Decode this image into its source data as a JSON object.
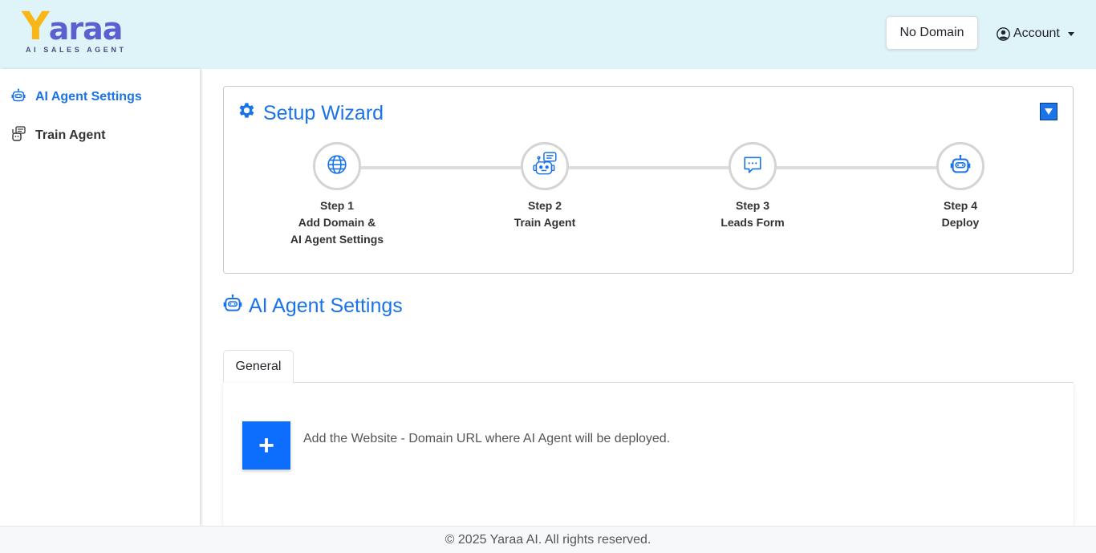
{
  "brand": {
    "logo_initial": "Y",
    "logo_rest": "araa",
    "tagline": "AI SALES AGENT",
    "colors": {
      "logo_yellow": "#f8b618",
      "logo_purple": "#5b5fcf",
      "accent": "#1a73e8",
      "header_bg": "#dff4f9",
      "primary_button": "#0d6efd"
    }
  },
  "header": {
    "domain_button": "No Domain",
    "account_label": "Account",
    "account_icon": "user-circle-icon"
  },
  "sidebar": {
    "items": [
      {
        "label": "AI Agent Settings",
        "icon": "robot-icon",
        "active": true
      },
      {
        "label": "Train Agent",
        "icon": "train-agent-icon",
        "active": false
      }
    ]
  },
  "wizard": {
    "title": "Setup Wizard",
    "title_icon": "gear-icon",
    "toggle_icon": "collapse-toggle-icon",
    "steps": [
      {
        "step": "Step 1",
        "line1": "Add Domain &",
        "line2": "AI Agent Settings",
        "icon": "globe-icon"
      },
      {
        "step": "Step 2",
        "line1": "Train Agent",
        "line2": "",
        "icon": "robot-chat-icon"
      },
      {
        "step": "Step 3",
        "line1": "Leads Form",
        "line2": "",
        "icon": "chat-bubble-icon"
      },
      {
        "step": "Step 4",
        "line1": "Deploy",
        "line2": "",
        "icon": "robot-icon"
      }
    ]
  },
  "main": {
    "section_title": "AI Agent Settings",
    "section_icon": "robot-icon",
    "tabs": [
      {
        "label": "General",
        "active": true
      }
    ],
    "add_button": "+",
    "add_text": "Add the Website - Domain URL where AI Agent will be deployed."
  },
  "footer": {
    "text": "© 2025 Yaraa AI. All rights reserved."
  }
}
